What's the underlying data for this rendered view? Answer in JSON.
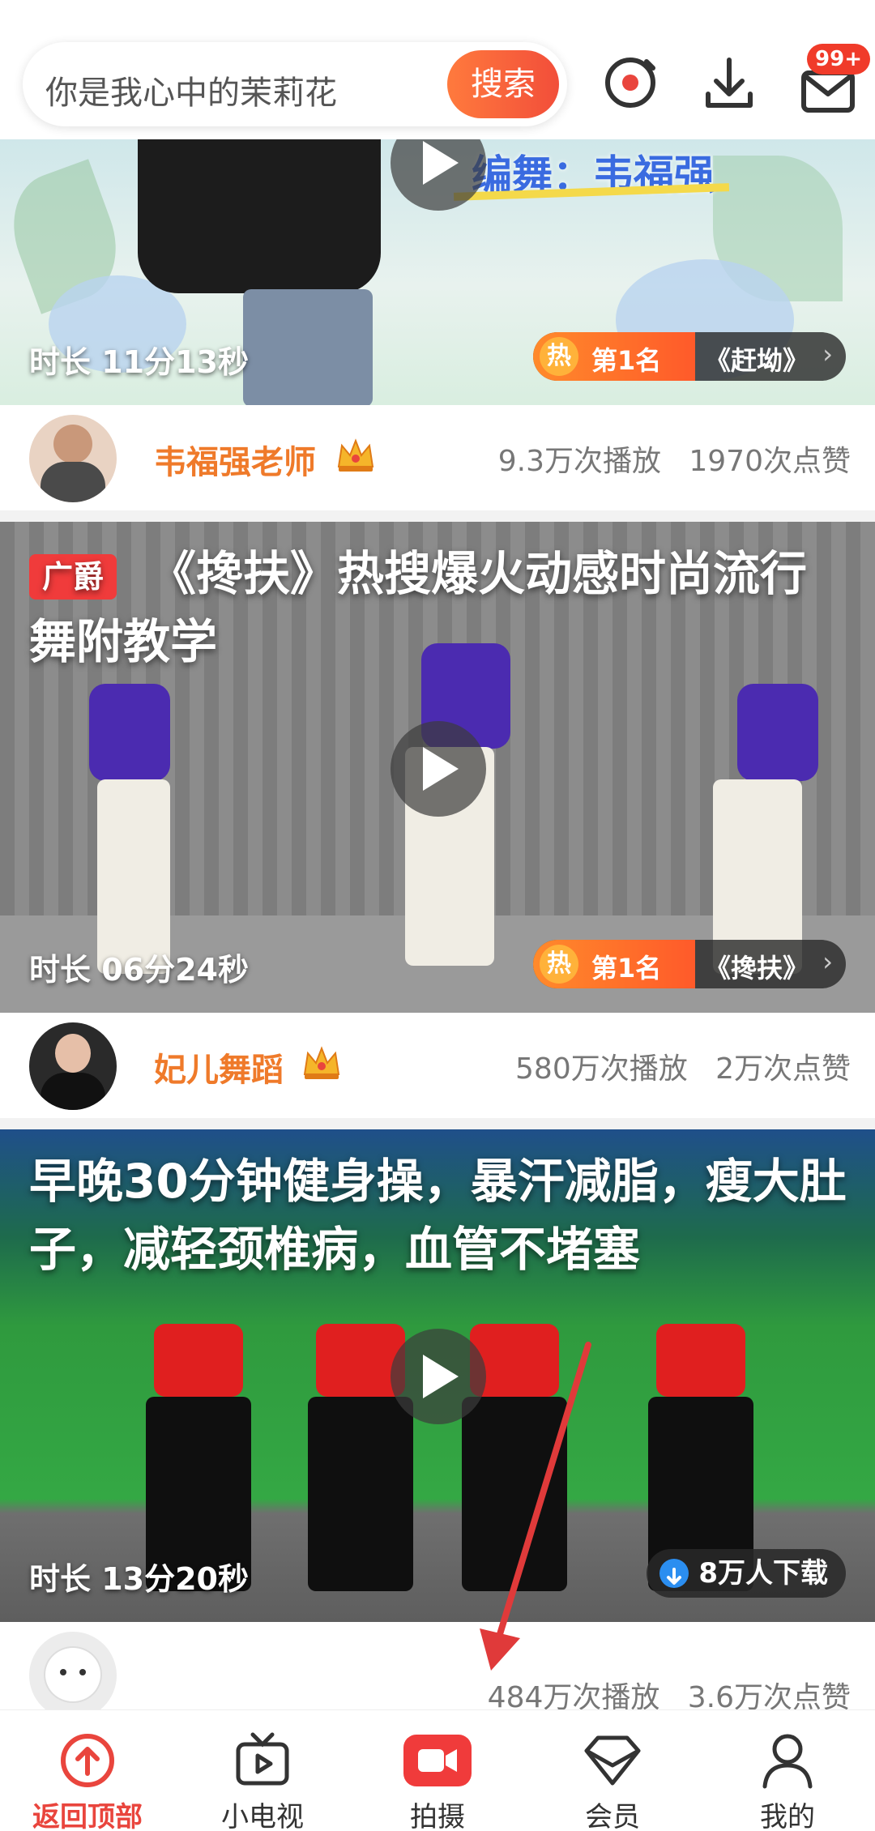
{
  "search": {
    "placeholder": "你是我心中的茉莉花",
    "button_label": "搜索"
  },
  "header": {
    "badge": "99+"
  },
  "videos": [
    {
      "cover_text": "编舞：韦福强",
      "duration": "时长  11分13秒",
      "hot_icon": "热",
      "hot_rank": "第1名",
      "hot_song": "《赶坳》",
      "author": "韦福强老师",
      "plays": "9.3万次播放",
      "likes": "1970次点赞"
    },
    {
      "ad_tag": "广爵",
      "title": "《搀扶》热搜爆火动感时尚流行舞附教学",
      "duration": "时长  06分24秒",
      "hot_icon": "热",
      "hot_rank": "第1名",
      "hot_song": "《搀扶》",
      "author": "妃儿舞蹈",
      "plays": "580万次播放",
      "likes": "2万次点赞"
    },
    {
      "title": "早晚30分钟健身操，暴汗减脂，瘦大肚子，减轻颈椎病，血管不堵塞",
      "duration": "时长  13分20秒",
      "downloads": "8万人下载",
      "plays": "484万次播放",
      "likes": "3.6万次点赞"
    }
  ],
  "nav": [
    {
      "label": "返回顶部",
      "icon": "back-to-top-icon",
      "active": true
    },
    {
      "label": "小电视",
      "icon": "tv-icon",
      "active": false
    },
    {
      "label": "拍摄",
      "icon": "camera-icon",
      "active": false
    },
    {
      "label": "会员",
      "icon": "diamond-icon",
      "active": false
    },
    {
      "label": "我的",
      "icon": "profile-icon",
      "active": false
    }
  ],
  "colors": {
    "accent": "#e9453d",
    "author": "#ef7a2a",
    "search_button": "#f25a3a"
  }
}
